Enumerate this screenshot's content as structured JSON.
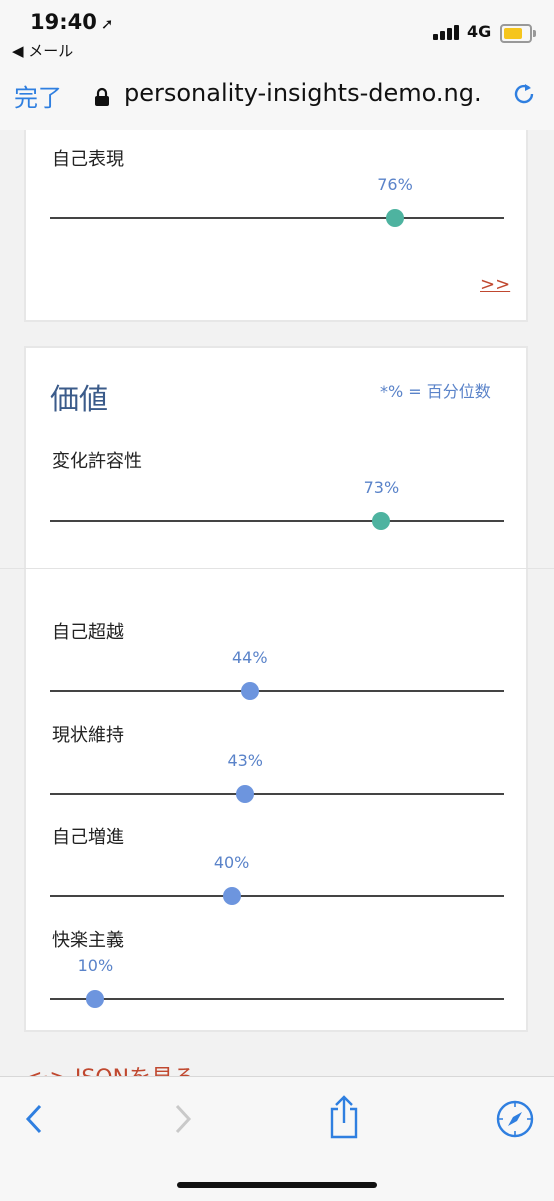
{
  "status_bar": {
    "time": "19:40",
    "location_arrow": "➚",
    "back_app": "◀ メール",
    "network": "4G"
  },
  "browser": {
    "done_label": "完了",
    "url": "personality-insights-demo.ng.",
    "icons": [
      "lock-icon",
      "reload-icon",
      "back-icon",
      "forward-icon",
      "share-icon",
      "compass-icon"
    ]
  },
  "card_top": {
    "trait": {
      "label": "自己表現",
      "percent_text": "76%",
      "value": 0.76,
      "color": "#4eb3a0"
    },
    "more_link": ">>"
  },
  "card_values": {
    "title": "価値",
    "note": "*% = 百分位数",
    "main_trait": {
      "label": "変化許容性",
      "percent_text": "73%",
      "value": 0.73,
      "color": "#4eb3a0"
    },
    "sub_traits": [
      {
        "label": "自己超越",
        "percent_text": "44%",
        "value": 0.44,
        "color": "#6d95de"
      },
      {
        "label": "現状維持",
        "percent_text": "43%",
        "value": 0.43,
        "color": "#6d95de"
      },
      {
        "label": "自己増進",
        "percent_text": "40%",
        "value": 0.4,
        "color": "#6d95de"
      },
      {
        "label": "快楽主義",
        "percent_text": "10%",
        "value": 0.1,
        "color": "#6d95de"
      }
    ]
  },
  "json_link": "<·> JSONを見る"
}
